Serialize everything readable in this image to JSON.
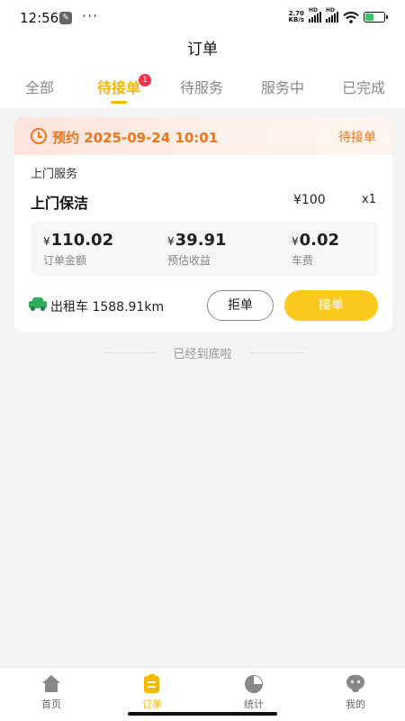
{
  "status_bar": {
    "time": "12:56",
    "dots": "···",
    "net_speed_value": "2.70",
    "net_speed_unit": "KB/s",
    "signal_label": "HD"
  },
  "header": {
    "title": "订单"
  },
  "tabs": [
    {
      "label": "全部",
      "active": false
    },
    {
      "label": "待接单",
      "active": true,
      "badge": "1"
    },
    {
      "label": "待服务",
      "active": false
    },
    {
      "label": "服务中",
      "active": false
    },
    {
      "label": "已完成",
      "active": false
    }
  ],
  "order": {
    "appointment": "预约 2025-09-24 10:01",
    "status": "待接单",
    "service_type": "上门服务",
    "service_name": "上门保洁",
    "service_price": "¥100",
    "service_qty": "x1",
    "amounts": [
      {
        "currency": "¥",
        "value": "110.02",
        "label": "订单金额"
      },
      {
        "currency": "¥",
        "value": "39.91",
        "label": "预估收益"
      },
      {
        "currency": "¥",
        "value": "0.02",
        "label": "车费"
      }
    ],
    "transport": "出租车 1588.91km",
    "reject_label": "拒单",
    "accept_label": "接单"
  },
  "list_end": "已经到底啦",
  "bottom_nav": [
    {
      "label": "首页",
      "icon": "home-icon",
      "active": false
    },
    {
      "label": "订单",
      "icon": "order-icon",
      "active": true
    },
    {
      "label": "统计",
      "icon": "stats-icon",
      "active": false
    },
    {
      "label": "我的",
      "icon": "me-icon",
      "active": false
    }
  ],
  "colors": {
    "accent": "#f5b800",
    "accept_button": "#fbc91b",
    "status_orange": "#e8771f",
    "badge_red": "#f0334a",
    "taxi_green": "#2fae5a"
  }
}
